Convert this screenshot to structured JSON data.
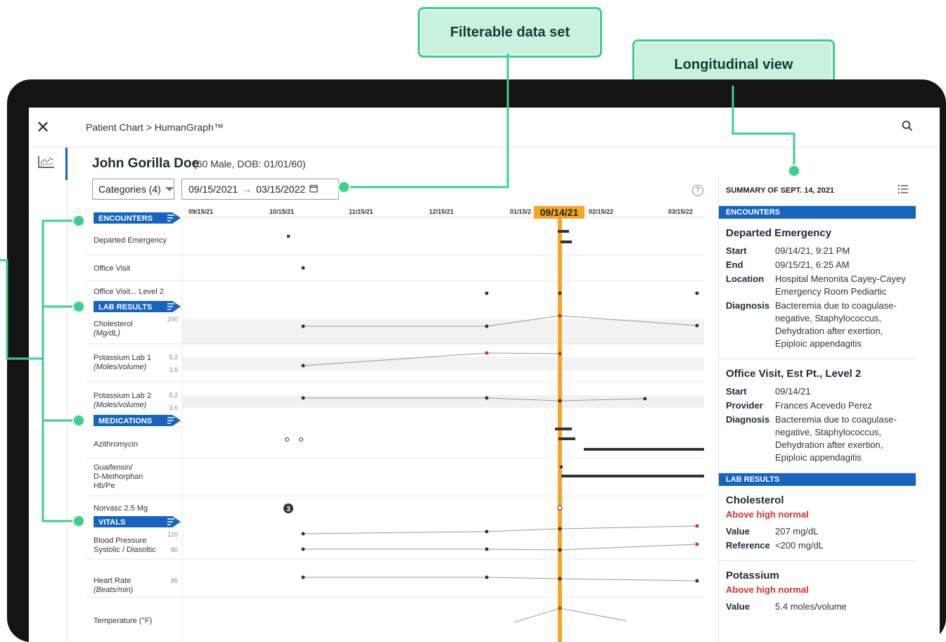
{
  "callouts": {
    "filterable": "Filterable data set",
    "longitudinal": "Longitudinal view"
  },
  "topbar": {
    "breadcrumb": "Patient Chart > HumanGraph™"
  },
  "patient": {
    "name": "John Gorilla Doe",
    "info": "(60 Male, DOB: 01/01/60)"
  },
  "filters": {
    "categories_label": "Categories (4)",
    "date_start": "09/15/2021",
    "date_arrow": "→",
    "date_end": "03/15/2022"
  },
  "timeline": {
    "axis_ticks": [
      "09/15/21",
      "10/15/21",
      "11/15/21",
      "12/15/21",
      "01/15/2",
      "02/15/22",
      "03/15/22"
    ],
    "selected_date": "09/14/21",
    "categories": {
      "encounters": "ENCOUNTERS",
      "lab_results": "LAB RESULTS",
      "medications": "MEDICATIONS",
      "vitals": "VITALS"
    },
    "rows": {
      "departed_emergency": "Departed Emergency",
      "office_visit": "Office Visit",
      "office_visit_l2": "Office Visit... Level 2",
      "cholesterol": "Cholesterol",
      "cholesterol_unit": "(Mg/dL)",
      "cholesterol_tick": "200",
      "potassium1": "Potassium Lab 1",
      "potassium1_unit": "(Moles/volume)",
      "potassium2": "Potassium Lab 2",
      "potassium2_unit": "(Moles/volume)",
      "potassium_tick_hi": "5.2",
      "potassium_tick_lo": "3.6",
      "azithromycin": "Azithromycin",
      "guaifensin_1": "Guaifensin/",
      "guaifensin_2": "D-Methorphan",
      "guaifensin_3": "Hb/Pe",
      "norvasc": "Norvasc 2.5 Mg",
      "norvasc_count": "3",
      "bp_1": "Blood Pressure",
      "bp_2": "Systolic / Diasoltic",
      "bp_tick_hi": "120",
      "bp_tick_lo": "80",
      "hr": "Heart Rate",
      "hr_unit": "(Beats/min)",
      "hr_tick": "85",
      "temp": "Temperature (°F)"
    }
  },
  "summary": {
    "header": "SUMMARY OF SEPT. 14, 2021",
    "encounters_label": "ENCOUNTERS",
    "enc1": {
      "title": "Departed Emergency",
      "start_k": "Start",
      "start_v": "09/14/21, 9:21 PM",
      "end_k": "End",
      "end_v": "09/15/21, 6:25 AM",
      "loc_k": "Location",
      "loc_v": "Hospital Menonita Cayey-Cayey Emergency Room Pediartic",
      "diag_k": "Diagnosis",
      "diag_v": "Bacteremia due to coagulase-negative, Staphylococcus, Dehydration after exertion, Epiploic appendagitis"
    },
    "enc2": {
      "title": "Office Visit, Est Pt., Level 2",
      "start_k": "Start",
      "start_v": "09/14/21",
      "prov_k": "Provider",
      "prov_v": "Frances Acevedo Perez",
      "diag_k": "Diagnosis",
      "diag_v": "Bacteremia due to coagulase-negative, Staphylococcus, Dehydration after exertion, Epiploic appendagitis"
    },
    "lab_label": "LAB RESULTS",
    "lab1": {
      "title": "Cholesterol",
      "status": "Above high normal",
      "value_k": "Value",
      "value_v": "207 mg/dL",
      "ref_k": "Reference",
      "ref_v": "<200 mg/dL"
    },
    "lab2": {
      "title": "Potassium",
      "status": "Above high normal",
      "value_k": "Value",
      "value_v": "5.4 moles/volume"
    }
  },
  "colors": {
    "accent_blue": "#1565c0",
    "callout_green": "#3ecf8e",
    "highlight_orange": "#f5a623",
    "alert_red": "#d32f2f"
  }
}
